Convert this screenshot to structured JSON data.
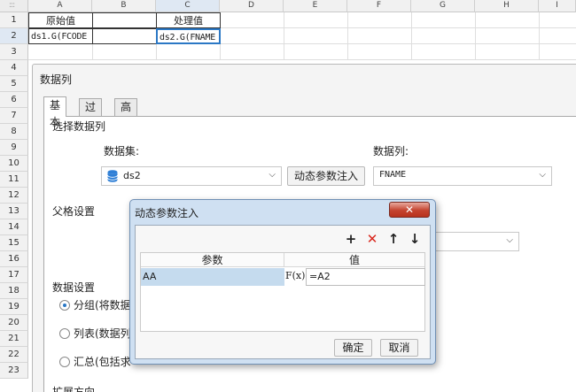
{
  "sheet": {
    "corner_glyph": ":::",
    "columns": [
      "A",
      "B",
      "C",
      "D",
      "E",
      "F",
      "G",
      "H",
      "I"
    ],
    "rows": [
      "1",
      "2",
      "3",
      "4",
      "5",
      "6",
      "7",
      "8",
      "9",
      "10",
      "11",
      "12",
      "13",
      "14",
      "15",
      "16",
      "17",
      "18",
      "19",
      "20",
      "21",
      "22",
      "23"
    ],
    "cells": {
      "a1": "原始值",
      "c1": "处理值",
      "a2": "ds1.G(FCODE",
      "c2": "ds2.G(FNAME"
    }
  },
  "dialog": {
    "title": "数据列",
    "tabs": [
      "基本",
      "过滤",
      "高级"
    ],
    "section_select": "选择数据列",
    "dataset_label": "数据集:",
    "column_label": "数据列:",
    "dataset_value": "ds2",
    "dynamic_param_button": "动态参数注入",
    "column_value": "FNAME",
    "section_parent": "父格设置",
    "section_data": "数据设置",
    "radio_group": "分组(将数据",
    "radio_list": "列表(数据列",
    "radio_sum": "汇总(包括求",
    "section_expand": "扩展方向"
  },
  "popup": {
    "title": "动态参数注入",
    "close_glyph": "✕",
    "toolbar": {
      "add": "+",
      "delete": "✕",
      "up": "↑",
      "down": "↓"
    },
    "columns": [
      "参数",
      "值"
    ],
    "param_name": "AA",
    "fx_label": "F(x)",
    "param_value": "=A2",
    "ok": "确定",
    "cancel": "取消"
  },
  "colors": {
    "accent": "#2b78c5",
    "delete_icon": "#d9261c",
    "close_button": "#c4432f",
    "selected_row": "#c5dbee",
    "popup_frame": "#cfe0f2",
    "dataset_icon": "#2f7fd6"
  }
}
